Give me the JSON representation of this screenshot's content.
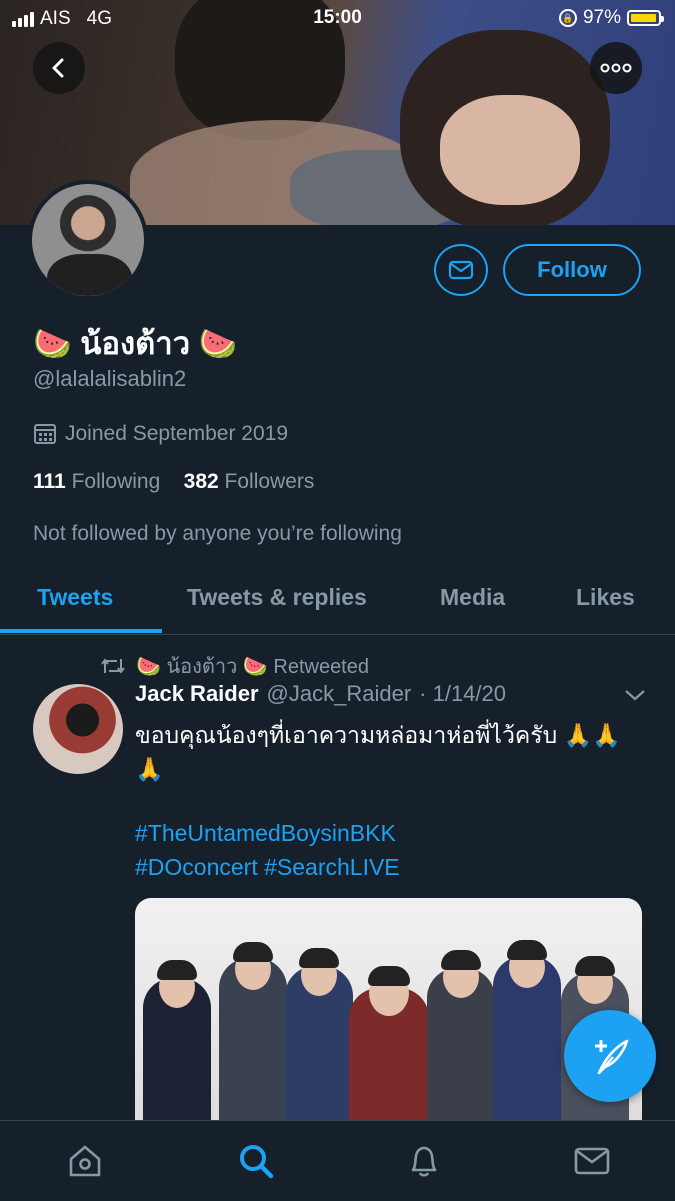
{
  "status_bar": {
    "carrier": "AIS",
    "network": "4G",
    "time": "15:00",
    "battery": "97%",
    "battery_level": 0.97
  },
  "profile": {
    "name": "🍉 น้องต้าว 🍉",
    "handle": "@lalalalisablin2",
    "joined": "Joined September 2019",
    "following_count": "111",
    "following_label": "Following",
    "followers_count": "382",
    "followers_label": "Followers",
    "not_followed_text": "Not followed by anyone you’re following",
    "follow_label": "Follow"
  },
  "tabs": [
    {
      "label": "Tweets",
      "active": true
    },
    {
      "label": "Tweets & replies",
      "active": false
    },
    {
      "label": "Media",
      "active": false
    },
    {
      "label": "Likes",
      "active": false
    }
  ],
  "tweet": {
    "retweet_text": "🍉 น้องต้าว 🍉  Retweeted",
    "author_name": "Jack Raider",
    "author_handle": "@Jack_Raider",
    "date": "· 1/14/20",
    "text": "ขอบคุณน้องๆที่เอาความหล่อมาห่อพี่ไว้ครับ 🙏🙏🙏",
    "hashtags_line1": "#TheUntamedBoysinBKK",
    "hashtags_line2": "#DOconcert #SearchLIVE"
  },
  "colors": {
    "accent": "#1da1f2",
    "background": "#15202b",
    "muted": "#8899a6"
  },
  "icons": {
    "back": "chevron-left-icon",
    "more": "more-icon",
    "mail": "mail-icon",
    "calendar": "calendar-icon",
    "retweet": "retweet-icon",
    "caret": "chevron-down-icon",
    "compose": "compose-tweet-icon",
    "nav": [
      "home-icon",
      "search-icon",
      "notifications-icon",
      "messages-icon"
    ]
  }
}
